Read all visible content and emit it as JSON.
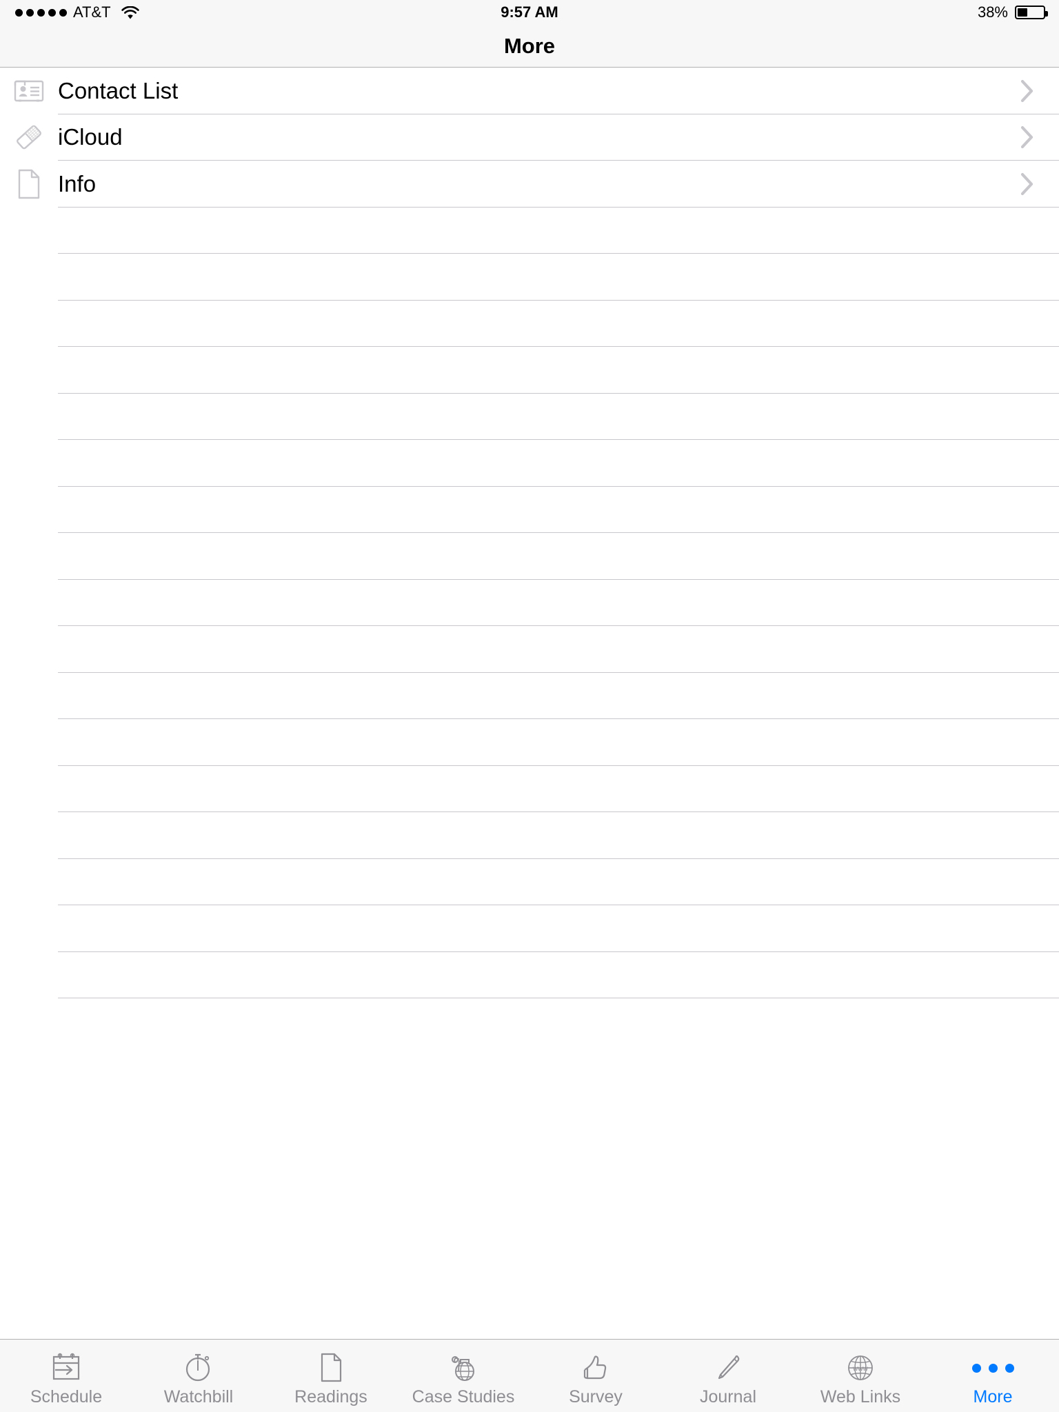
{
  "status_bar": {
    "signal_dots": 5,
    "carrier": "AT&T",
    "wifi_icon": "wifi-icon",
    "time": "9:57 AM",
    "battery_percent": "38%",
    "battery_level": 38
  },
  "nav": {
    "title": "More"
  },
  "list": {
    "items": [
      {
        "label": "Contact List",
        "icon": "contact-card-icon"
      },
      {
        "label": "iCloud",
        "icon": "eraser-icon"
      },
      {
        "label": "Info",
        "icon": "document-icon"
      }
    ],
    "empty_row_count": 17
  },
  "tab_bar": {
    "active_index": 7,
    "active_color": "#007aff",
    "inactive_color": "#8e8e93",
    "tabs": [
      {
        "label": "Schedule",
        "icon": "calendar-arrow-icon"
      },
      {
        "label": "Watchbill",
        "icon": "stopwatch-icon"
      },
      {
        "label": "Readings",
        "icon": "document-icon"
      },
      {
        "label": "Case Studies",
        "icon": "grenade-icon"
      },
      {
        "label": "Survey",
        "icon": "thumbs-up-icon"
      },
      {
        "label": "Journal",
        "icon": "pen-icon"
      },
      {
        "label": "Web Links",
        "icon": "globe-www-icon"
      },
      {
        "label": "More",
        "icon": "ellipsis-icon"
      }
    ]
  }
}
